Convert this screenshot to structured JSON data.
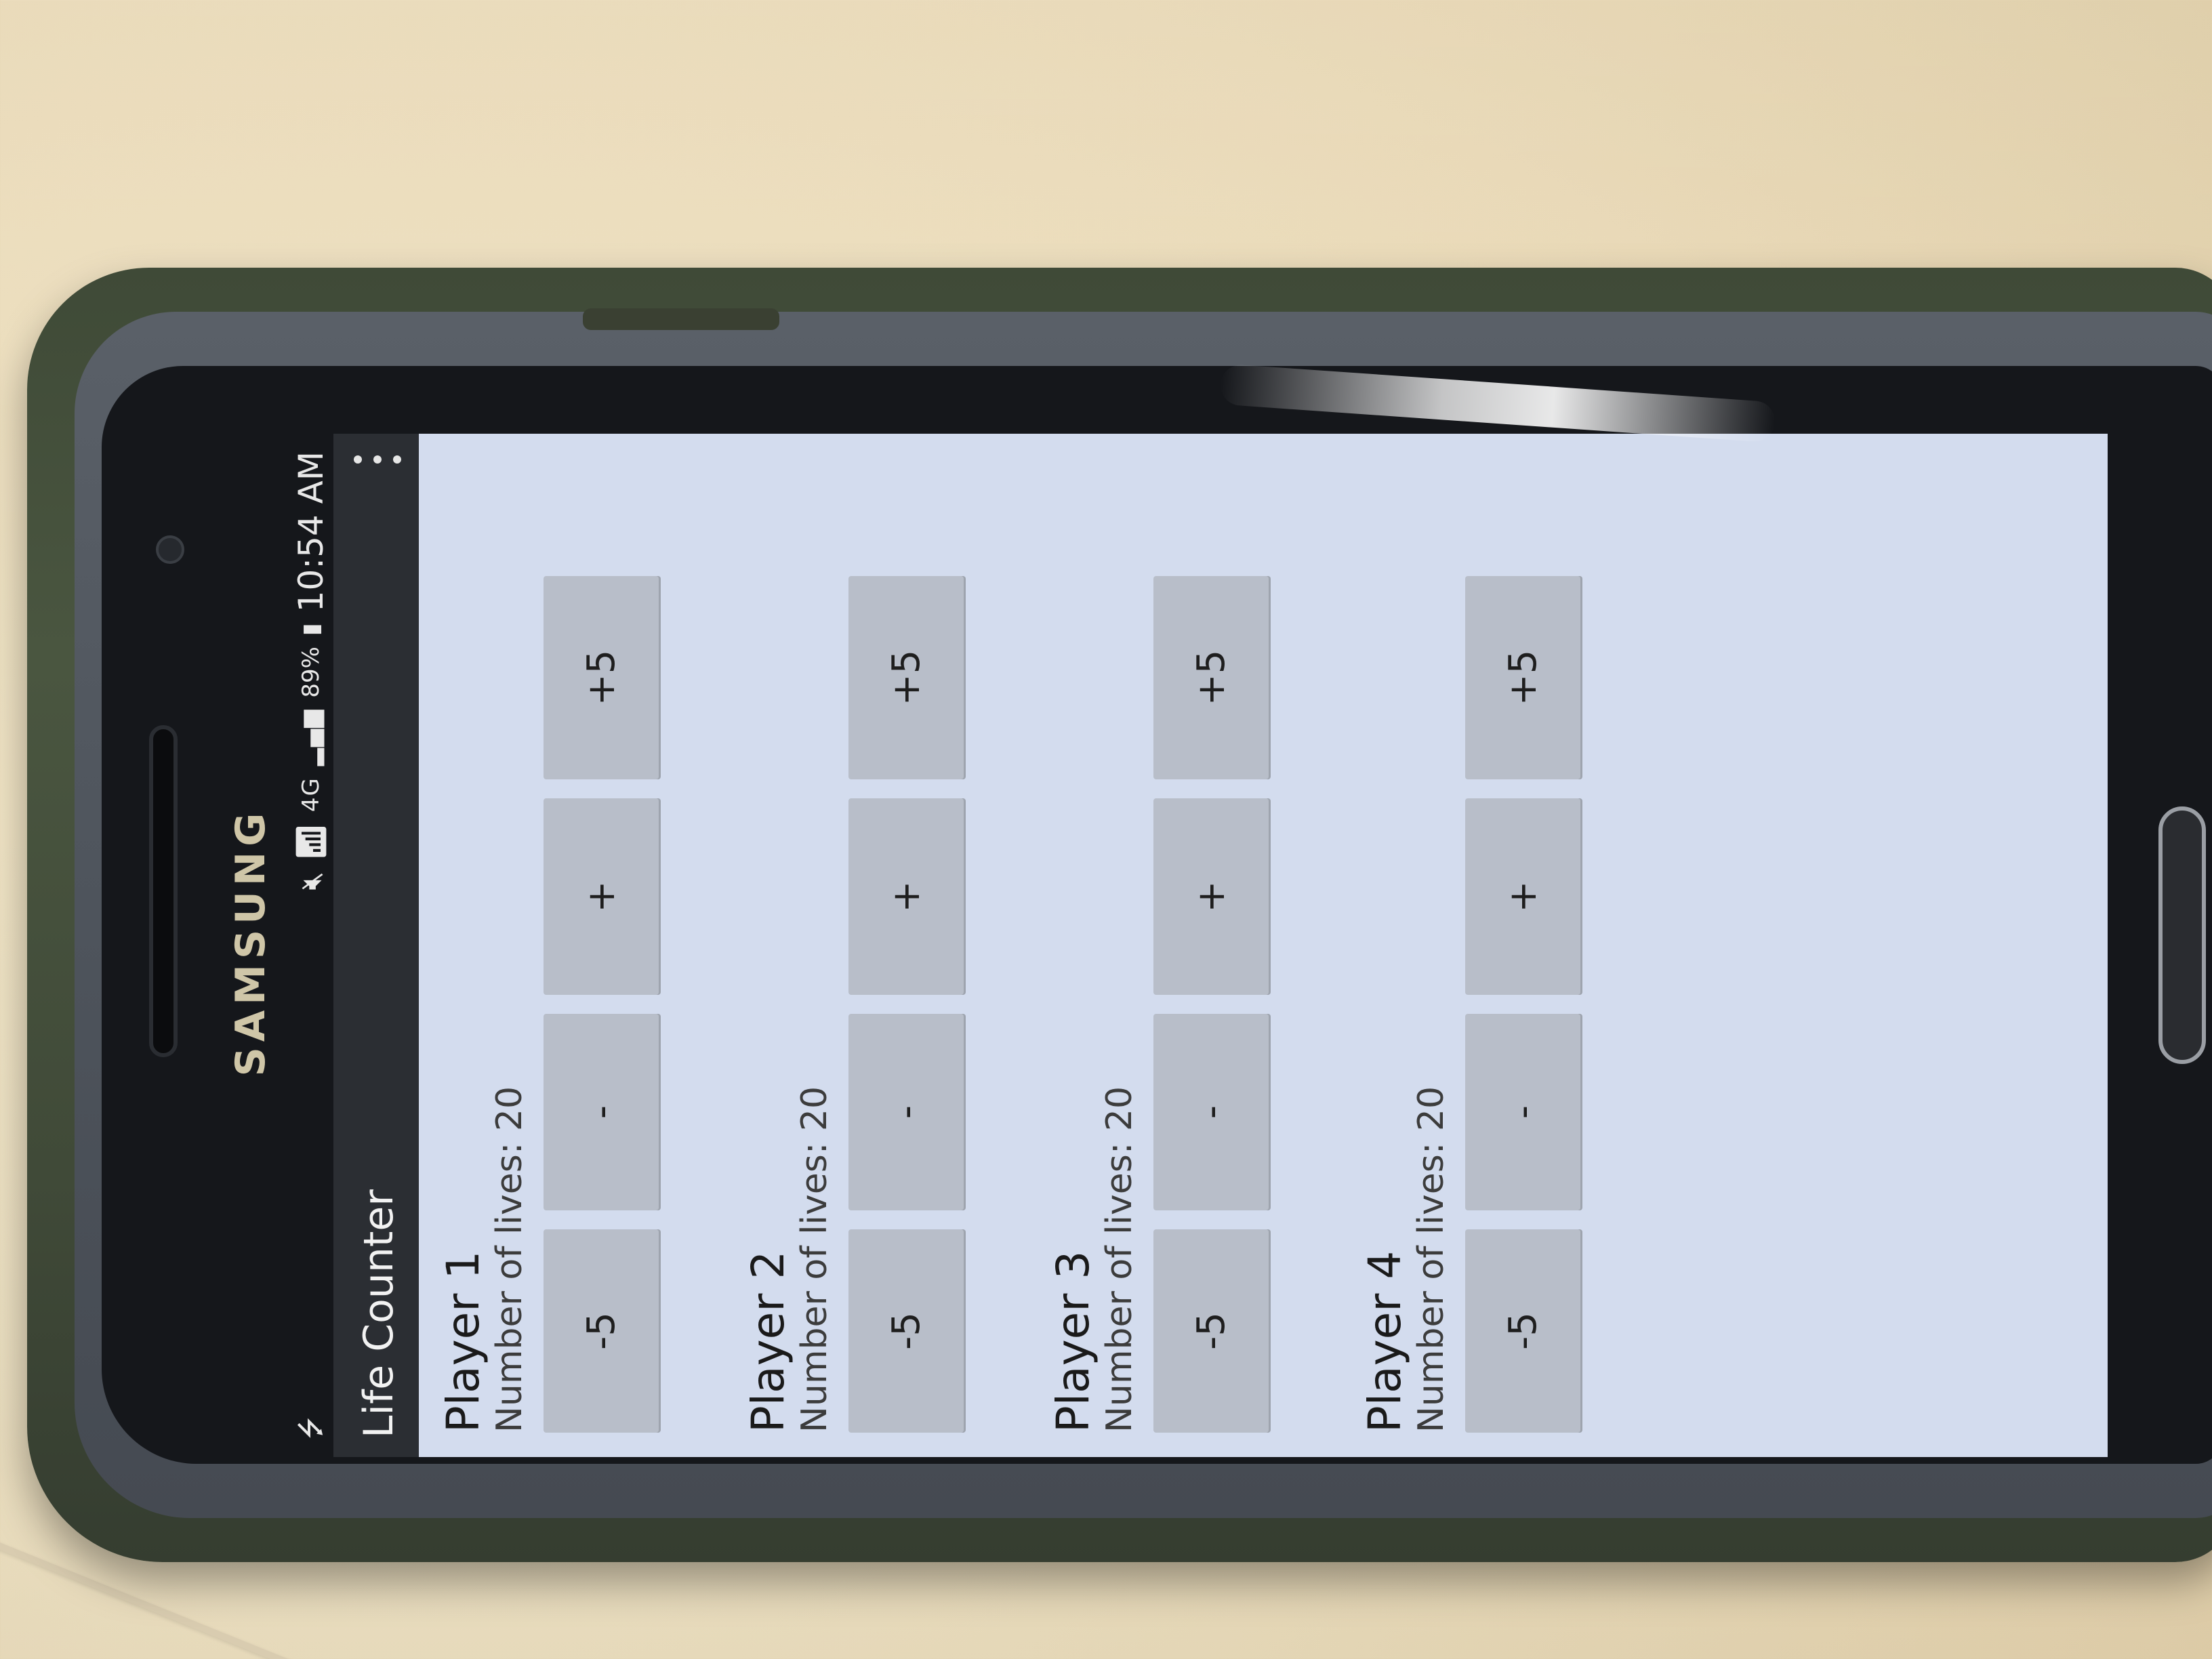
{
  "device": {
    "brand_text": "SAMSUNG"
  },
  "status_bar": {
    "left_icon": "usb-icon",
    "signal_label": "4G",
    "battery_percent": "89%",
    "time": "10:54 AM"
  },
  "action_bar": {
    "title": "Life Counter",
    "overflow_icon": "overflow-menu-icon"
  },
  "players": [
    {
      "name": "Player 1",
      "lives": "Number of lives: 20",
      "buttons": [
        "-5",
        "-",
        "+",
        "+5"
      ]
    },
    {
      "name": "Player 2",
      "lives": "Number of lives: 20",
      "buttons": [
        "-5",
        "-",
        "+",
        "+5"
      ]
    },
    {
      "name": "Player 3",
      "lives": "Number of lives: 20",
      "buttons": [
        "-5",
        "-",
        "+",
        "+5"
      ]
    },
    {
      "name": "Player 4",
      "lives": "Number of lives: 20",
      "buttons": [
        "-5",
        "-",
        "+",
        "+5"
      ]
    }
  ],
  "colors": {
    "app_background": "#d3dcee",
    "button": "#b8bec9",
    "action_bar": "#2b2e33",
    "status_bar": "#15171b"
  }
}
